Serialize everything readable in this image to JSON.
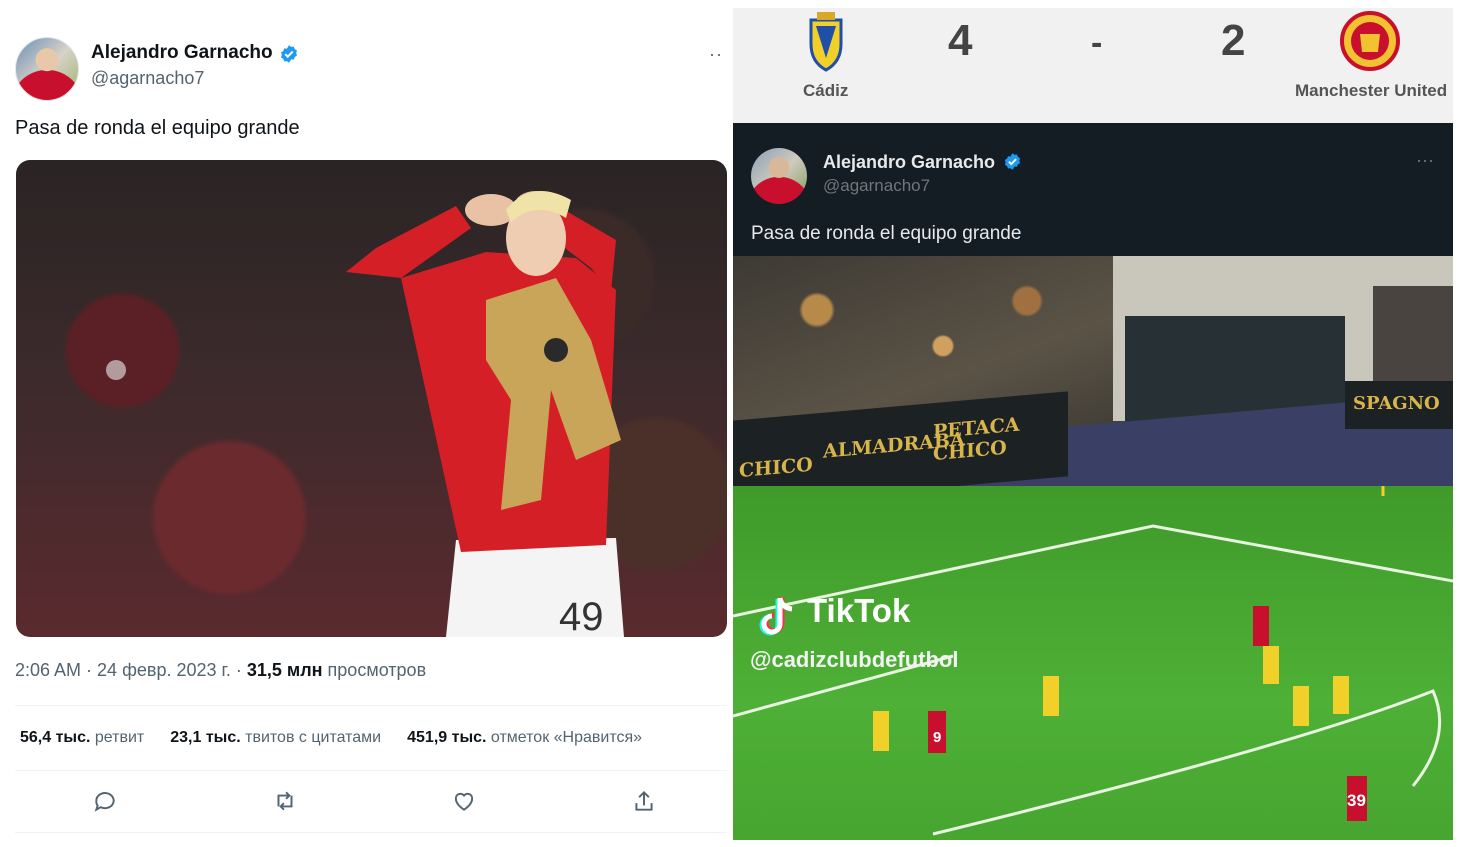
{
  "left_tweet": {
    "author_name": "Alejandro Garnacho",
    "handle": "@agarnacho7",
    "more_label": "··",
    "text": "Pasa de ronda el equipo grande",
    "meta": {
      "time": "2:06 AM",
      "sep1": " · ",
      "date": "24 февр. 2023 г.",
      "sep2": " · ",
      "views_count": "31,5 млн",
      "views_label": " просмотров"
    },
    "stats": {
      "retweets_count": "56,4 тыс.",
      "retweets_label": " ретвит",
      "quotes_count": "23,1 тыс.",
      "quotes_label": " твитов с цитатами",
      "likes_count": "451,9 тыс.",
      "likes_label": " отметок «Нравится»"
    },
    "photo": {
      "shirt_number": "49"
    }
  },
  "right_panel": {
    "scoreboard": {
      "home_team": "Cádiz",
      "home_score": "4",
      "separator": "-",
      "away_score": "2",
      "away_team": "Manchester United"
    },
    "tweet": {
      "author_name": "Alejandro Garnacho",
      "handle": "@agarnacho7",
      "more_label": "···",
      "text": "Pasa de ronda el equipo grande"
    },
    "video": {
      "tiktok_brand": "TikTok",
      "tiktok_handle": "@cadizclubdefutbol",
      "ad_boards": [
        "CHICO",
        "ALMADRABA",
        "PETACA CHICO",
        "SPAGNO"
      ],
      "player_numbers": [
        "9",
        "39"
      ]
    }
  },
  "colors": {
    "verified_blue": "#1d9bf0",
    "text_primary": "#0f1419",
    "text_secondary": "#536471",
    "united_red": "#c8102e",
    "cadiz_yellow": "#f2d02a"
  },
  "icons": [
    "verified-badge-icon",
    "reply-icon",
    "retweet-icon",
    "like-icon",
    "share-icon",
    "cadiz-crest-icon",
    "man-utd-crest-icon",
    "tiktok-logo-icon",
    "more-icon"
  ]
}
